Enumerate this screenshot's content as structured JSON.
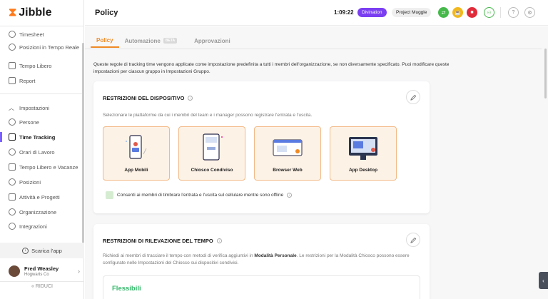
{
  "app": {
    "name": "Jibble"
  },
  "sidebar": {
    "items": [
      {
        "label": "Timesheet",
        "icon": "clock-icon"
      },
      {
        "label": "Posizioni in Tempo Reale",
        "icon": "location-pin-icon"
      },
      {
        "label": "Tempo Libero",
        "icon": "suitcase-icon"
      },
      {
        "label": "Report",
        "icon": "report-icon"
      }
    ],
    "settings_header": "Impostazioni",
    "settings_items": [
      {
        "label": "Persone",
        "icon": "person-icon"
      },
      {
        "label": "Time Tracking",
        "icon": "time-tracking-icon",
        "active": true
      },
      {
        "label": "Orari di Lavoro",
        "icon": "work-schedule-icon"
      },
      {
        "label": "Tempo Libero e Vacanze",
        "icon": "vacation-icon"
      },
      {
        "label": "Posizioni",
        "icon": "location-icon"
      },
      {
        "label": "Attività e Progetti",
        "icon": "tag-icon"
      },
      {
        "label": "Organizzazione",
        "icon": "gear-icon"
      },
      {
        "label": "Integrazioni",
        "icon": "integration-icon"
      }
    ],
    "download_label": "Scarica l'app",
    "user": {
      "name": "Fred Weasley",
      "org": "Hogwarts Co"
    },
    "collapse_label": "RIDUCI"
  },
  "topbar": {
    "title": "Policy",
    "timer": "1:09:22",
    "activity": "Divination",
    "project": "Project Muggle"
  },
  "tabs": [
    {
      "label": "Policy",
      "active": true
    },
    {
      "label": "Automazione",
      "badge": "BETA"
    },
    {
      "label": "Approvazioni"
    }
  ],
  "intro": "Queste regole di tracking time vengono applicate come impostazione predefinita a tutti i membri dell'organizzazione, se non diversamente specificato. Puoi modificare queste impostazioni per ciascun gruppo in Impostazioni Gruppo.",
  "device_section": {
    "title": "RESTRIZIONI DEL DISPOSITIVO",
    "description": "Selezionare le piattaforme da cui i membri del team e i manager possono registrare l'entrata e l'uscita.",
    "platforms": [
      "App Mobili",
      "Chiosco Condiviso",
      "Browser Web",
      "App Desktop"
    ],
    "offline_label": "Consenti ai membri di timbrare l'entrata e l'uscita sul cellulare mentre sono offline"
  },
  "tracking_section": {
    "title": "RESTRIZIONI DI RILEVAZIONE DEL TEMPO",
    "description_part1": "Richiedi ai membri di tracciare il tempo con metodi di verifica aggiuntivi in ",
    "description_bold": "Modalità Personale",
    "description_part2": ". Le restrizioni per la Modalità Chiosco possono essere configurate nelle Impostazioni del Chiosco sui dispositivi condivisi.",
    "mode_title": "Flessibili"
  },
  "colors": {
    "accent": "#f08a24",
    "brand_purple": "#7b3ff2",
    "flexible_green": "#35b96b"
  }
}
